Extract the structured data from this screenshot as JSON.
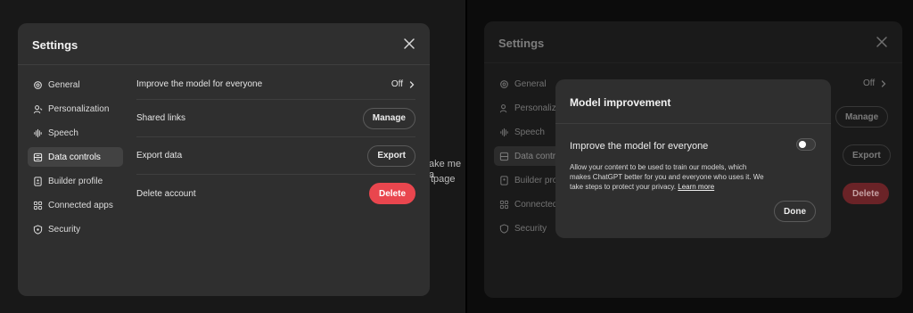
{
  "left": {
    "background_text": [
      "ake me a",
      "tpage"
    ],
    "settings": {
      "title": "Settings",
      "nav": [
        {
          "label": "General",
          "icon": "gear-icon"
        },
        {
          "label": "Personalization",
          "icon": "person-icon"
        },
        {
          "label": "Speech",
          "icon": "waveform-icon"
        },
        {
          "label": "Data controls",
          "icon": "database-icon",
          "active": true
        },
        {
          "label": "Builder profile",
          "icon": "id-card-icon"
        },
        {
          "label": "Connected apps",
          "icon": "grid-icon"
        },
        {
          "label": "Security",
          "icon": "shield-icon"
        }
      ],
      "rows": {
        "improve_label": "Improve the model for everyone",
        "improve_value": "Off",
        "shared_links_label": "Shared links",
        "shared_links_button": "Manage",
        "export_label": "Export data",
        "export_button": "Export",
        "delete_label": "Delete account",
        "delete_button": "Delete"
      }
    }
  },
  "right": {
    "settings": {
      "title": "Settings",
      "nav": [
        {
          "label": "General"
        },
        {
          "label": "Personalizati"
        },
        {
          "label": "Speech"
        },
        {
          "label": "Data contro"
        },
        {
          "label": "Builder prof"
        },
        {
          "label": "Connected"
        },
        {
          "label": "Security"
        }
      ],
      "rows": {
        "improve_value": "Off",
        "shared_links_button": "Manage",
        "export_button": "Export",
        "delete_button": "Delete"
      }
    },
    "dialog": {
      "title": "Model improvement",
      "toggle_label": "Improve the model for everyone",
      "toggle_state": "off",
      "description": "Allow your content to be used to train our models, which makes ChatGPT better for you and everyone who uses it. We take steps to protect your privacy.",
      "link": "Learn more",
      "done_button": "Done"
    }
  },
  "colors": {
    "modal_bg": "#2f2f2f",
    "danger": "#e9464e",
    "page_bg": "#111111"
  }
}
